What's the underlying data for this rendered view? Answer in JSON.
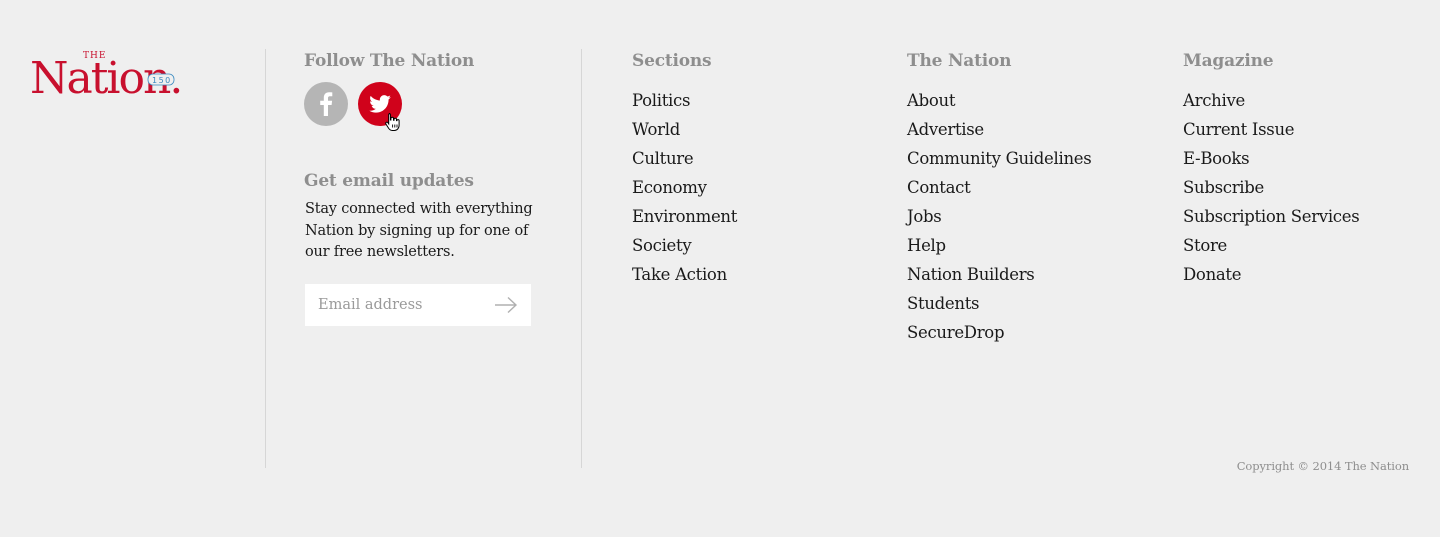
{
  "logo": {
    "main_text": "Nation.",
    "small_text": "THE",
    "badge_text": "150",
    "brand_color": "#c8102e",
    "badge_color": "#3a8ac0"
  },
  "follow": {
    "heading": "Follow The Nation",
    "social": [
      {
        "name": "facebook",
        "icon": "facebook-icon",
        "color": "#b5b5b5"
      },
      {
        "name": "twitter",
        "icon": "twitter-icon",
        "color": "#d0021b"
      }
    ]
  },
  "email": {
    "heading": "Get email updates",
    "description": "Stay connected with everything Nation by signing up for one of our free newsletters.",
    "placeholder": "Email address",
    "value": ""
  },
  "sections": {
    "heading": "Sections",
    "links": [
      "Politics",
      "World",
      "Culture",
      "Economy",
      "Environment",
      "Society",
      "Take Action"
    ]
  },
  "the_nation": {
    "heading": "The Nation",
    "links": [
      "About",
      "Advertise",
      "Community Guidelines",
      "Contact",
      "Jobs",
      "Help",
      "Nation Builders",
      "Students",
      "SecureDrop"
    ]
  },
  "magazine": {
    "heading": "Magazine",
    "links": [
      "Archive",
      "Current Issue",
      "E-Books",
      "Subscribe",
      "Subscription Services",
      "Store",
      "Donate"
    ]
  },
  "copyright": "Copyright © 2014 The Nation"
}
